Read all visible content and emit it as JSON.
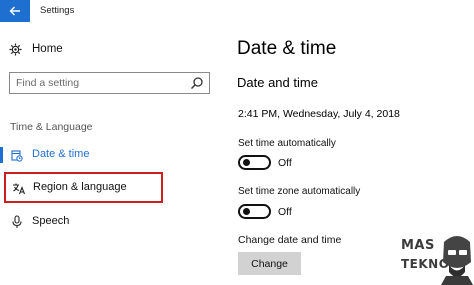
{
  "titlebar": {
    "title": "Settings",
    "back_icon": "back-arrow-icon",
    "accent": "#1f6fd1"
  },
  "sidebar": {
    "home_label": "Home",
    "search_placeholder": "Find a setting",
    "section_label": "Time & Language",
    "items": [
      {
        "label": "Date & time",
        "icon": "clock-calendar-icon",
        "active": true
      },
      {
        "label": "Region & language",
        "icon": "language-icon",
        "highlighted": true
      },
      {
        "label": "Speech",
        "icon": "microphone-icon"
      }
    ],
    "highlight_color": "#cc1f1f"
  },
  "main": {
    "page_title": "Date & time",
    "subtitle": "Date and time",
    "current_datetime": "2:41 PM, Wednesday, July 4, 2018",
    "set_time_auto": {
      "label": "Set time automatically",
      "state": "Off"
    },
    "set_timezone_auto": {
      "label": "Set time zone automatically",
      "state": "Off"
    },
    "change_section_label": "Change date and time",
    "change_button": "Change"
  },
  "watermark": {
    "line1": "MAS",
    "line2": "TEKNO"
  }
}
